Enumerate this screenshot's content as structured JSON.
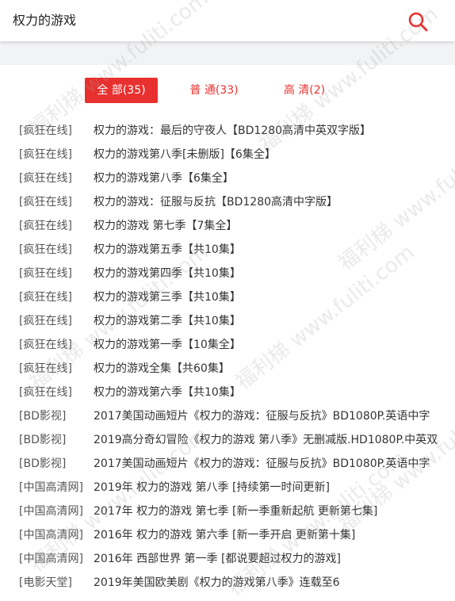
{
  "search": {
    "query": "权力的游戏"
  },
  "tabs": [
    {
      "label": "全 部(35)",
      "active": true
    },
    {
      "label": "普 通(33)",
      "active": false
    },
    {
      "label": "高 清(2)",
      "active": false
    }
  ],
  "results": [
    {
      "source": "[疯狂在线]",
      "title": "权力的游戏：最后的守夜人【BD1280高清中英双字版】"
    },
    {
      "source": "[疯狂在线]",
      "title": "权力的游戏第八季[未删版]【6集全】"
    },
    {
      "source": "[疯狂在线]",
      "title": "权力的游戏第八季【6集全】"
    },
    {
      "source": "[疯狂在线]",
      "title": "权力的游戏：征服与反抗【BD1280高清中字版】"
    },
    {
      "source": "[疯狂在线]",
      "title": "权力的游戏 第七季【7集全】"
    },
    {
      "source": "[疯狂在线]",
      "title": "权力的游戏第五季【共10集】"
    },
    {
      "source": "[疯狂在线]",
      "title": "权力的游戏第四季【共10集】"
    },
    {
      "source": "[疯狂在线]",
      "title": "权力的游戏第三季【共10集】"
    },
    {
      "source": "[疯狂在线]",
      "title": "权力的游戏第二季【共10集】"
    },
    {
      "source": "[疯狂在线]",
      "title": "权力的游戏第一季【10集全】"
    },
    {
      "source": "[疯狂在线]",
      "title": "权力的游戏全集【共60集】"
    },
    {
      "source": "[疯狂在线]",
      "title": "权力的游戏第六季【共10集】"
    },
    {
      "source": "[BD影视]",
      "title": "2017美国动画短片《权力的游戏：征服与反抗》BD1080P.英语中字"
    },
    {
      "source": "[BD影视]",
      "title": "2019高分奇幻冒险《权力的游戏 第八季》无删减版.HD1080P.中英双"
    },
    {
      "source": "[BD影视]",
      "title": "2017美国动画短片《权力的游戏：征服与反抗》BD1080P.英语中字"
    },
    {
      "source": "[中国高清网]",
      "title": "2019年 权力的游戏 第八季 [持续第一时间更新]"
    },
    {
      "source": "[中国高清网]",
      "title": "2017年 权力的游戏 第七季 [新一季重新起航 更新第七集]"
    },
    {
      "source": "[中国高清网]",
      "title": "2016年 权力的游戏 第六季 [新一季开启 更新第十集]"
    },
    {
      "source": "[中国高清网]",
      "title": "2016年 西部世界 第一季 [都说要超过权力的游戏]"
    },
    {
      "source": "[电影天堂]",
      "title": "2019年美国欧美剧《权力的游戏第八季》连载至6"
    }
  ],
  "watermark": {
    "text": "福利梯 www.fuliti.com"
  },
  "colors": {
    "accent": "#e8312f"
  }
}
